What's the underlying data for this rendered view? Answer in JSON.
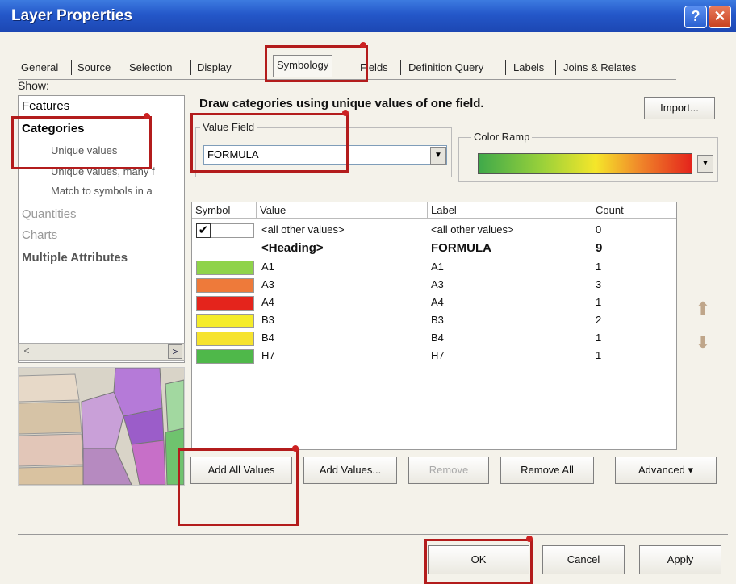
{
  "window": {
    "title": "Layer Properties",
    "help": "?",
    "close": "✕"
  },
  "tabs": [
    "General",
    "Source",
    "Selection",
    "Display",
    "Symbology",
    "Fields",
    "Definition Query",
    "Labels",
    "Joins & Relates"
  ],
  "show": {
    "label": "Show:",
    "items": [
      {
        "label": "Features"
      },
      {
        "label": "Categories"
      },
      {
        "label": "Unique values"
      },
      {
        "label": "Unique values, many f"
      },
      {
        "label": "Match to symbols in a"
      },
      {
        "label": "Quantities"
      },
      {
        "label": "Charts"
      },
      {
        "label": "Multiple Attributes"
      }
    ]
  },
  "symbology": {
    "heading": "Draw categories using unique values of one field.",
    "import_label": "Import...",
    "value_field_title": "Value Field",
    "value_field_value": "FORMULA",
    "color_ramp_title": "Color Ramp"
  },
  "table": {
    "headers": [
      "Symbol",
      "Value",
      "Label",
      "Count"
    ],
    "rows": [
      {
        "value": "<all other values>",
        "label": "<all other values>",
        "count": "0",
        "color": "#ffffff"
      },
      {
        "value": "<Heading>",
        "label": "FORMULA",
        "count": "9",
        "color": ""
      },
      {
        "value": "A1",
        "label": "A1",
        "count": "1",
        "color": "#8fd34a"
      },
      {
        "value": "A3",
        "label": "A3",
        "count": "3",
        "color": "#ee7a3a"
      },
      {
        "value": "A4",
        "label": "A4",
        "count": "1",
        "color": "#e4241c"
      },
      {
        "value": "B3",
        "label": "B3",
        "count": "2",
        "color": "#f5ec2a"
      },
      {
        "value": "B4",
        "label": "B4",
        "count": "1",
        "color": "#f6e32e"
      },
      {
        "value": "H7",
        "label": "H7",
        "count": "1",
        "color": "#4fb84a"
      }
    ]
  },
  "buttons": {
    "add_all": "Add All Values",
    "add_values": "Add Values...",
    "remove": "Remove",
    "remove_all": "Remove All",
    "advanced": "Advanced ▾",
    "ok": "OK",
    "cancel": "Cancel",
    "apply": "Apply"
  },
  "icons": {
    "up": "up-arrow-icon",
    "down": "down-arrow-icon"
  }
}
